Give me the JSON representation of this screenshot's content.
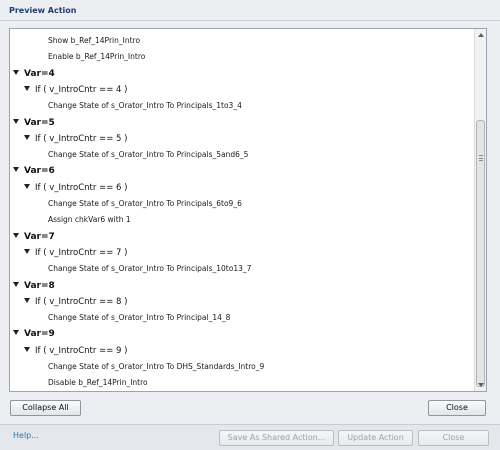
{
  "dialog": {
    "title": "Preview Action",
    "help_label": "Help...",
    "collapse_all_label": "Collapse All",
    "close_label": "Close",
    "footer": {
      "save_shared_label": "Save As Shared Action...",
      "update_label": "Update Action",
      "close_label": "Close"
    }
  },
  "tree": [
    {
      "kind": "action",
      "text": "Show b_Ref_14Prin_Intro"
    },
    {
      "kind": "action",
      "text": "Enable b_Ref_14Prin_Intro"
    },
    {
      "kind": "var",
      "text": "Var=4"
    },
    {
      "kind": "cond",
      "text": "If ( v_IntroCntr == 4  )"
    },
    {
      "kind": "action",
      "text": "Change State of s_Orator_Intro To Principals_1to3_4"
    },
    {
      "kind": "var",
      "text": "Var=5"
    },
    {
      "kind": "cond",
      "text": "If ( v_IntroCntr == 5  )"
    },
    {
      "kind": "action",
      "text": "Change State of s_Orator_Intro To Principals_5and6_5"
    },
    {
      "kind": "var",
      "text": "Var=6"
    },
    {
      "kind": "cond",
      "text": "If ( v_IntroCntr == 6  )"
    },
    {
      "kind": "action",
      "text": "Change State of s_Orator_Intro To Principals_6to9_6"
    },
    {
      "kind": "action",
      "text": "Assign chkVar6 with 1"
    },
    {
      "kind": "var",
      "text": "Var=7"
    },
    {
      "kind": "cond",
      "text": "If ( v_IntroCntr == 7  )"
    },
    {
      "kind": "action",
      "text": "Change State of s_Orator_Intro To Principals_10to13_7"
    },
    {
      "kind": "var",
      "text": "Var=8"
    },
    {
      "kind": "cond",
      "text": "If ( v_IntroCntr == 8  )"
    },
    {
      "kind": "action",
      "text": "Change State of s_Orator_Intro To Principal_14_8"
    },
    {
      "kind": "var",
      "text": "Var=9"
    },
    {
      "kind": "cond",
      "text": "If ( v_IntroCntr == 9  )"
    },
    {
      "kind": "action",
      "text": "Change State of s_Orator_Intro To DHS_Standards_Intro_9"
    },
    {
      "kind": "action",
      "text": "Disable b_Ref_14Prin_Intro"
    }
  ]
}
